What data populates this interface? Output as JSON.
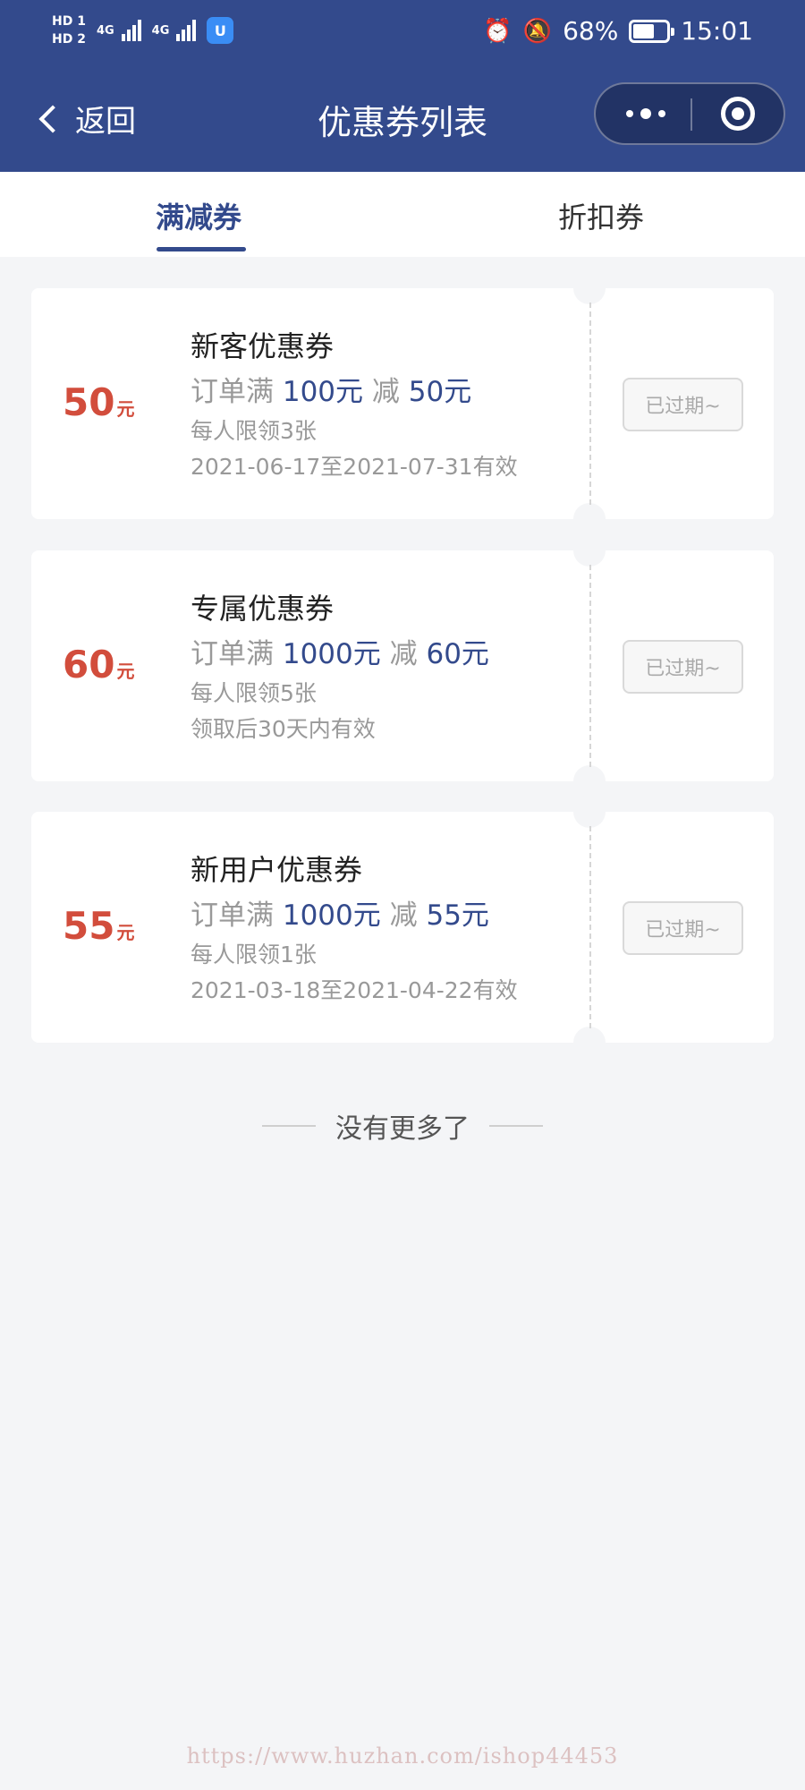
{
  "status_bar": {
    "sim1": "HD 1",
    "sim2": "HD 2",
    "net1": "4G",
    "net2": "4G",
    "app_badge": "U",
    "battery_level": 68,
    "battery_text": "68%",
    "time": "15:01",
    "icons": [
      "alarm-icon",
      "bell-off-icon",
      "battery-icon"
    ]
  },
  "nav": {
    "back_label": "返回",
    "title": "优惠券列表",
    "capsule_icons": [
      "more-dots-icon",
      "target-icon"
    ]
  },
  "tabs": [
    {
      "label": "满减券",
      "active": true
    },
    {
      "label": "折扣券",
      "active": false
    }
  ],
  "coupons": [
    {
      "amount": "50",
      "unit": "元",
      "name": "新客优惠券",
      "rule_prefix": "订单满",
      "threshold": "100元",
      "rule_mid": "减",
      "discount": "50元",
      "limit": "每人限领3张",
      "validity": "2021-06-17至2021-07-31有效",
      "button": "已过期~"
    },
    {
      "amount": "60",
      "unit": "元",
      "name": "专属优惠券",
      "rule_prefix": "订单满",
      "threshold": "1000元",
      "rule_mid": "减",
      "discount": "60元",
      "limit": "每人限领5张",
      "validity": "领取后30天内有效",
      "button": "已过期~"
    },
    {
      "amount": "55",
      "unit": "元",
      "name": "新用户优惠券",
      "rule_prefix": "订单满",
      "threshold": "1000元",
      "rule_mid": "减",
      "discount": "55元",
      "limit": "每人限领1张",
      "validity": "2021-03-18至2021-04-22有效",
      "button": "已过期~"
    }
  ],
  "footer": {
    "no_more": "没有更多了",
    "watermark": "https://www.huzhan.com/ishop44453"
  },
  "colors": {
    "primary": "#334a8c",
    "amount": "#d24d3c",
    "background": "#f4f5f7",
    "muted": "#999999"
  }
}
